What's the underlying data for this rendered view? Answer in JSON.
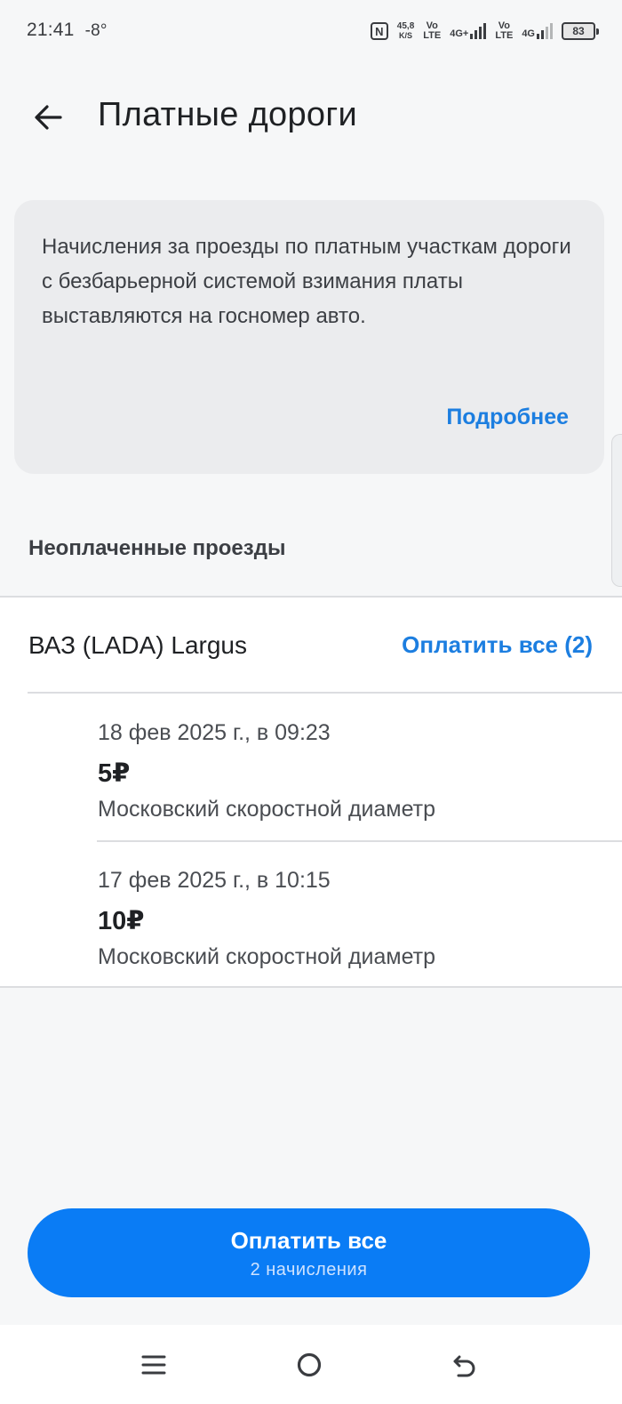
{
  "status_bar": {
    "time": "21:41",
    "temperature": "-8°",
    "speed_value": "45,8",
    "speed_unit": "K/S",
    "volte1": "Vo\nLTE",
    "net1": "4G+",
    "volte2": "Vo\nLTE",
    "net2": "4G",
    "battery": "83"
  },
  "header": {
    "title": "Платные дороги",
    "back_icon": "arrow-left-icon"
  },
  "info_card": {
    "text": "Начисления за проезды по платным участкам дороги с безбарьерной системой взимания платы выставляются на госномер авто.",
    "link": "Подробнее"
  },
  "unpaid": {
    "section_title": "Неоплаченные проезды",
    "car": {
      "name": "ВАЗ (LADA) Largus",
      "pay_all_link": "Оплатить все (2)"
    },
    "trips": [
      {
        "date": "18 фев 2025 г., в 09:23",
        "amount": "5₽",
        "road": "Московский скоростной диаметр"
      },
      {
        "date": "17 фев 2025 г., в 10:15",
        "amount": "10₽",
        "road": "Московский скоростной диаметр"
      }
    ]
  },
  "pay_button": {
    "label": "Оплатить все",
    "sub": "2 начисления"
  },
  "colors": {
    "accent": "#0a7cf5",
    "link": "#1c7ee0",
    "background": "#f6f7f8"
  },
  "nav_icons": [
    "menu-icon",
    "home-icon",
    "back-icon"
  ]
}
